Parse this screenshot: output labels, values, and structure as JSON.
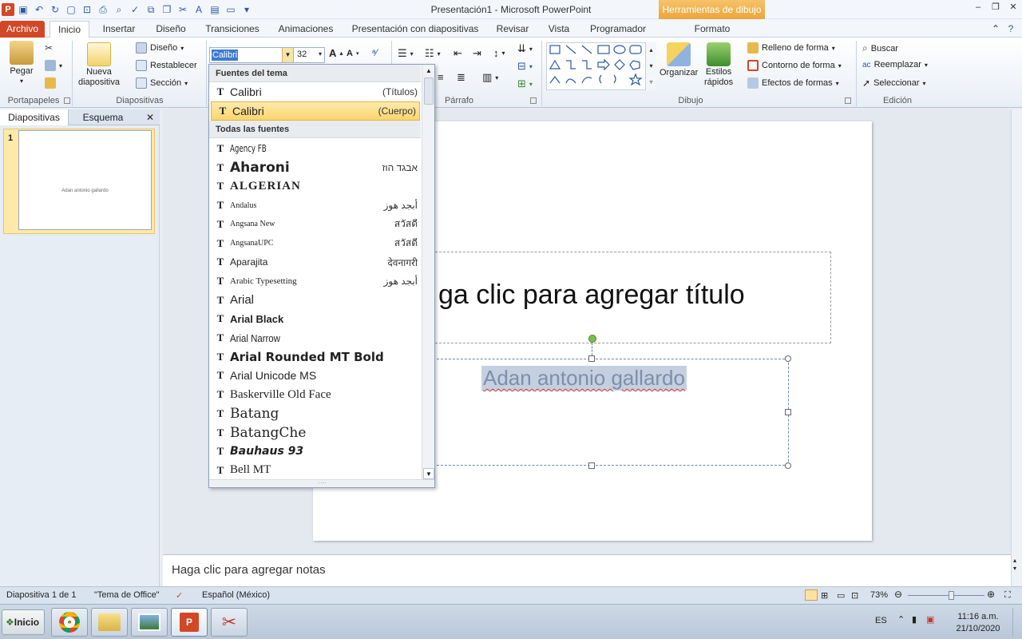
{
  "window": {
    "title": "Presentación1  -  Microsoft PowerPoint",
    "context_tool_title": "Herramientas de dibujo"
  },
  "tabs": [
    "Archivo",
    "Inicio",
    "Insertar",
    "Diseño",
    "Transiciones",
    "Animaciones",
    "Presentación con diapositivas",
    "Revisar",
    "Vista",
    "Programador",
    "Formato"
  ],
  "ribbon": {
    "portapapeles": {
      "label": "Portapapeles",
      "paste": "Pegar"
    },
    "diapositivas": {
      "label": "Diapositivas",
      "new_slide_line1": "Nueva",
      "new_slide_line2": "diapositiva",
      "layout": "Diseño",
      "reset": "Restablecer",
      "section": "Sección"
    },
    "fuente": {
      "font_value": "Calibri",
      "size_value": "32"
    },
    "parrafo": {
      "label": "Párrafo"
    },
    "dibujo": {
      "label": "Dibujo",
      "organize": "Organizar",
      "styles_line1": "Estilos",
      "styles_line2": "rápidos",
      "fill": "Relleno de forma",
      "outline": "Contorno de forma",
      "effects": "Efectos de formas"
    },
    "edicion": {
      "label": "Edición",
      "find": "Buscar",
      "replace": "Reemplazar",
      "select": "Seleccionar"
    }
  },
  "left_pane": {
    "tab_slides": "Diapositivas",
    "tab_outline": "Esquema",
    "slide_number": "1",
    "thumb_text": "Adan antonio gallardo"
  },
  "slide": {
    "title_placeholder": "Haga clic para agregar título",
    "title_visible": "ga clic para agregar título",
    "subtitle_text": "Adan antonio gallardo"
  },
  "notes": {
    "placeholder": "Haga clic para agregar notas"
  },
  "font_dropdown": {
    "theme_header": "Fuentes del tema",
    "theme_fonts": [
      {
        "name": "Calibri",
        "tag": "(Títulos)"
      },
      {
        "name": "Calibri",
        "tag": "(Cuerpo)",
        "selected": true
      }
    ],
    "all_header": "Todas las fuentes",
    "fonts": [
      {
        "name": "Agency FB",
        "sample": ""
      },
      {
        "name": "Aharoni",
        "sample": "אבגד הוז"
      },
      {
        "name": "ALGERIAN",
        "sample": ""
      },
      {
        "name": "Andalus",
        "sample": "أبجد هوز"
      },
      {
        "name": "Angsana New",
        "sample": "สวัสดี"
      },
      {
        "name": "AngsanaUPC",
        "sample": "สวัสดี"
      },
      {
        "name": "Aparajita",
        "sample": "देवनागरी"
      },
      {
        "name": "Arabic Typesetting",
        "sample": "أبجد هوز"
      },
      {
        "name": "Arial",
        "sample": ""
      },
      {
        "name": "Arial Black",
        "sample": ""
      },
      {
        "name": "Arial Narrow",
        "sample": ""
      },
      {
        "name": "Arial Rounded MT Bold",
        "sample": ""
      },
      {
        "name": "Arial Unicode MS",
        "sample": ""
      },
      {
        "name": "Baskerville Old Face",
        "sample": ""
      },
      {
        "name": "Batang",
        "sample": ""
      },
      {
        "name": "BatangChe",
        "sample": ""
      },
      {
        "name": "Bauhaus 93",
        "sample": ""
      },
      {
        "name": "Bell MT",
        "sample": ""
      }
    ]
  },
  "status": {
    "slide_info": "Diapositiva 1 de 1",
    "theme": "\"Tema de Office\"",
    "language": "Español (México)",
    "zoom": "73%",
    "zoom_fraction": 0.56
  },
  "taskbar": {
    "start": "Inicio",
    "lang": "ES",
    "time": "11:16 a.m.",
    "date": "21/10/2020"
  },
  "colors": {
    "accent": "#d24726",
    "selection": "#fbd56e",
    "context": "#eaa63a"
  }
}
